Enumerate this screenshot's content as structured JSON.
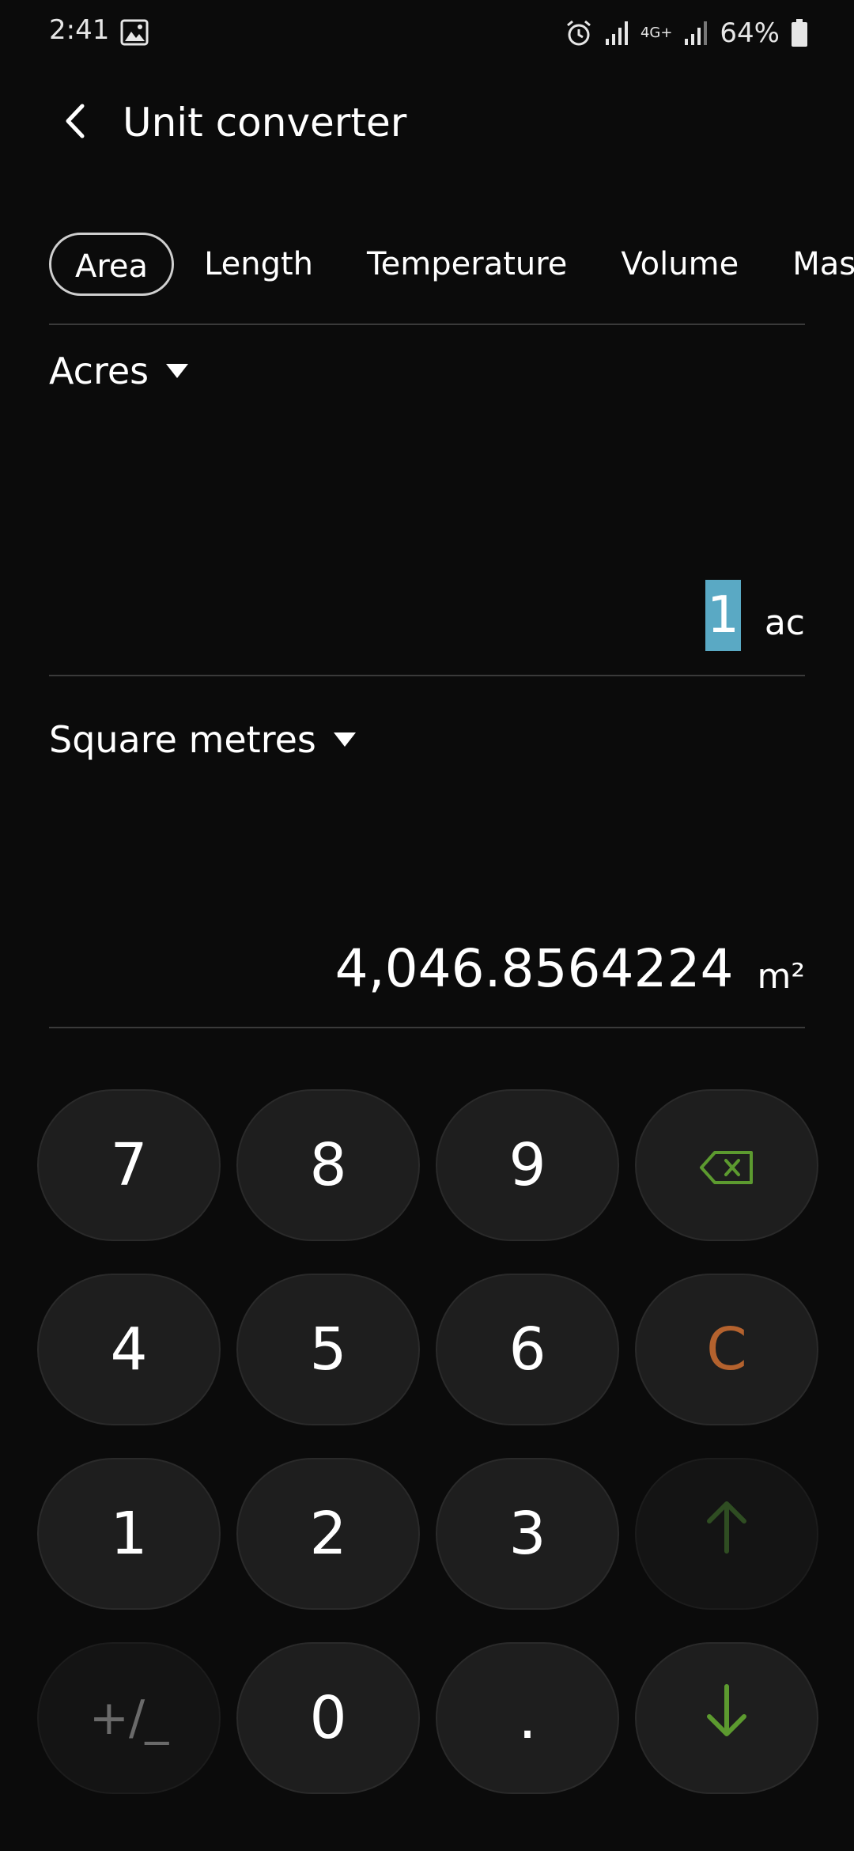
{
  "status_bar": {
    "time": "2:41",
    "network": "4G+",
    "battery": "64%"
  },
  "app_bar": {
    "title": "Unit converter"
  },
  "tabs": [
    {
      "label": "Area",
      "selected": true
    },
    {
      "label": "Length",
      "selected": false
    },
    {
      "label": "Temperature",
      "selected": false
    },
    {
      "label": "Volume",
      "selected": false
    },
    {
      "label": "Mass",
      "selected": false
    }
  ],
  "from_unit": {
    "name": "Acres",
    "value": "1",
    "abbr": "ac"
  },
  "to_unit": {
    "name": "Square metres",
    "value": "4,046.8564224",
    "abbr": "m²"
  },
  "keypad": {
    "k7": "7",
    "k8": "8",
    "k9": "9",
    "k4": "4",
    "k5": "5",
    "k6": "6",
    "k1": "1",
    "k2": "2",
    "k3": "3",
    "k0": "0",
    "clear": "C",
    "plus_minus": "+/_",
    "decimal": "."
  },
  "colors": {
    "background": "#0b0b0b",
    "key_bg": "#1e1e1e",
    "selection_highlight": "#5aa9c4",
    "clear_key": "#b4622e",
    "arrow_green": "#5c9a2f",
    "arrow_dim": "#2f4d22"
  },
  "icons": [
    "back-icon",
    "gallery-icon",
    "alarm-icon",
    "signal-icon",
    "battery-icon",
    "backspace-icon",
    "arrow-up-icon",
    "arrow-down-icon"
  ]
}
